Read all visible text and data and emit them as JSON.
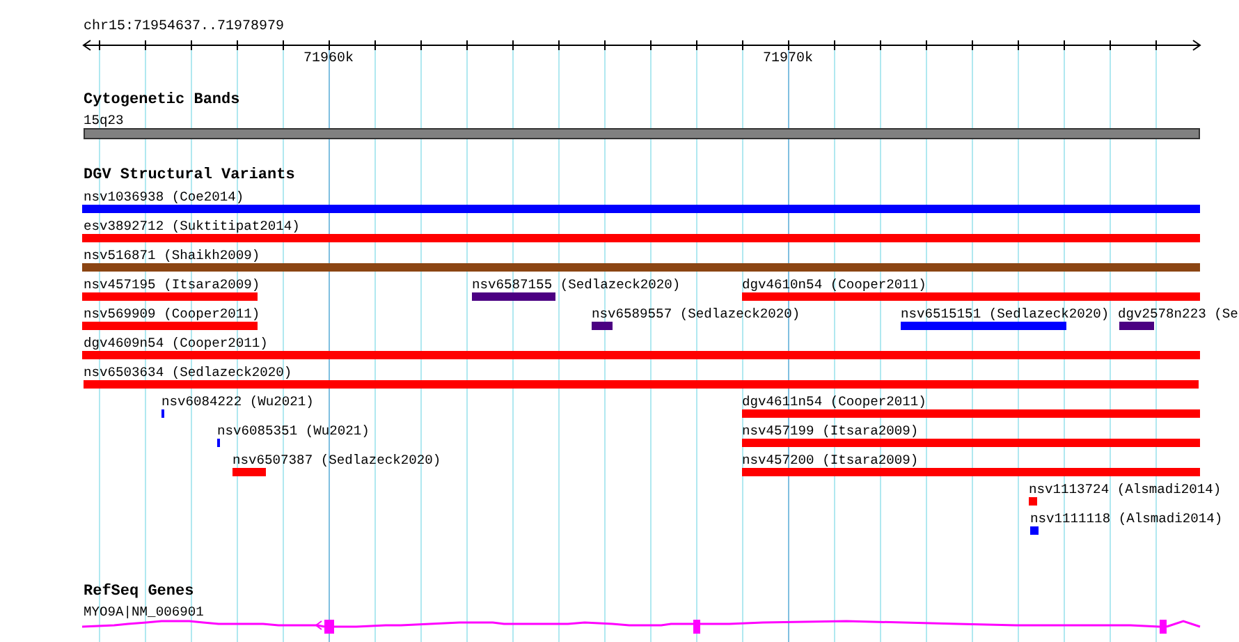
{
  "ruler": {
    "location": "chr15:71954637..71978979",
    "tick_labels": [
      "71960k",
      "71970k"
    ]
  },
  "cytogenetic_bands": {
    "title": "Cytogenetic Bands",
    "band": "15q23"
  },
  "dgv": {
    "title": "DGV Structural Variants",
    "variants": [
      {
        "label": "nsv1036938 (Coe2014)",
        "color": "#0000ff"
      },
      {
        "label": "esv3892712 (Suktitipat2014)",
        "color": "#ff0000"
      },
      {
        "label": "nsv516871 (Shaikh2009)",
        "color": "#8b4513"
      },
      {
        "label": "nsv457195 (Itsara2009)",
        "color": "#ff0000"
      },
      {
        "label": "nsv6587155 (Sedlazeck2020)",
        "color": "#4b0082"
      },
      {
        "label": "dgv4610n54 (Cooper2011)",
        "color": "#ff0000"
      },
      {
        "label": "nsv569909 (Cooper2011)",
        "color": "#ff0000"
      },
      {
        "label": "nsv6589557 (Sedlazeck2020)",
        "color": "#4b0082"
      },
      {
        "label": "nsv6515151 (Sedlazeck2020)",
        "color": "#0000ff"
      },
      {
        "label": "dgv2578n223 (Se",
        "color": "#4b0082"
      },
      {
        "label": "dgv4609n54 (Cooper2011)",
        "color": "#ff0000"
      },
      {
        "label": "nsv6503634 (Sedlazeck2020)",
        "color": "#ff0000"
      },
      {
        "label": "nsv6084222 (Wu2021)",
        "color": "#0000ff"
      },
      {
        "label": "dgv4611n54 (Cooper2011)",
        "color": "#ff0000"
      },
      {
        "label": "nsv6085351 (Wu2021)",
        "color": "#0000ff"
      },
      {
        "label": "nsv457199 (Itsara2009)",
        "color": "#ff0000"
      },
      {
        "label": "nsv6507387 (Sedlazeck2020)",
        "color": "#ff0000"
      },
      {
        "label": "nsv457200 (Itsara2009)",
        "color": "#ff0000"
      },
      {
        "label": "nsv1113724 (Alsmadi2014)",
        "color": "#ff0000"
      },
      {
        "label": "nsv1111118 (Alsmadi2014)",
        "color": "#0000ff"
      }
    ]
  },
  "refseq": {
    "title": "RefSeq Genes",
    "gene": "MYO9A|NM_006901"
  }
}
